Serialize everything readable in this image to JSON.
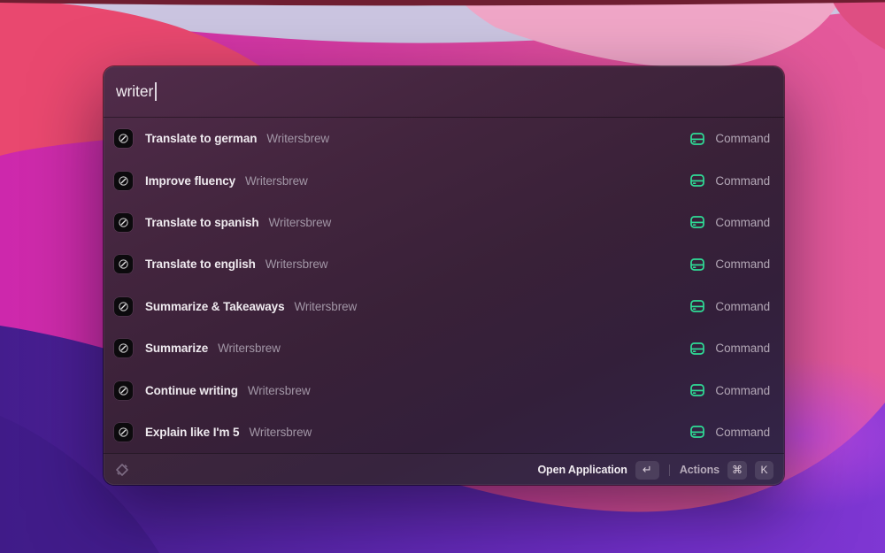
{
  "colors": {
    "accent_green": "#2fdd97",
    "window_tint": "#3c2138",
    "wallpaper_magenta": "#cd28ac",
    "wallpaper_pink": "#e4579a",
    "wallpaper_purple": "#6d2fc2"
  },
  "search": {
    "value": "writer"
  },
  "results": [
    {
      "title": "Translate to german",
      "app": "Writersbrew",
      "type": "Command"
    },
    {
      "title": "Improve fluency",
      "app": "Writersbrew",
      "type": "Command"
    },
    {
      "title": "Translate to spanish",
      "app": "Writersbrew",
      "type": "Command"
    },
    {
      "title": "Translate to english",
      "app": "Writersbrew",
      "type": "Command"
    },
    {
      "title": "Summarize & Takeaways",
      "app": "Writersbrew",
      "type": "Command"
    },
    {
      "title": "Summarize",
      "app": "Writersbrew",
      "type": "Command"
    },
    {
      "title": "Continue writing",
      "app": "Writersbrew",
      "type": "Command"
    },
    {
      "title": "Explain like I'm 5",
      "app": "Writersbrew",
      "type": "Command"
    }
  ],
  "footer": {
    "primary_action": "Open Application",
    "primary_key": "↵",
    "secondary_action": "Actions",
    "secondary_keys": [
      "⌘",
      "K"
    ]
  }
}
